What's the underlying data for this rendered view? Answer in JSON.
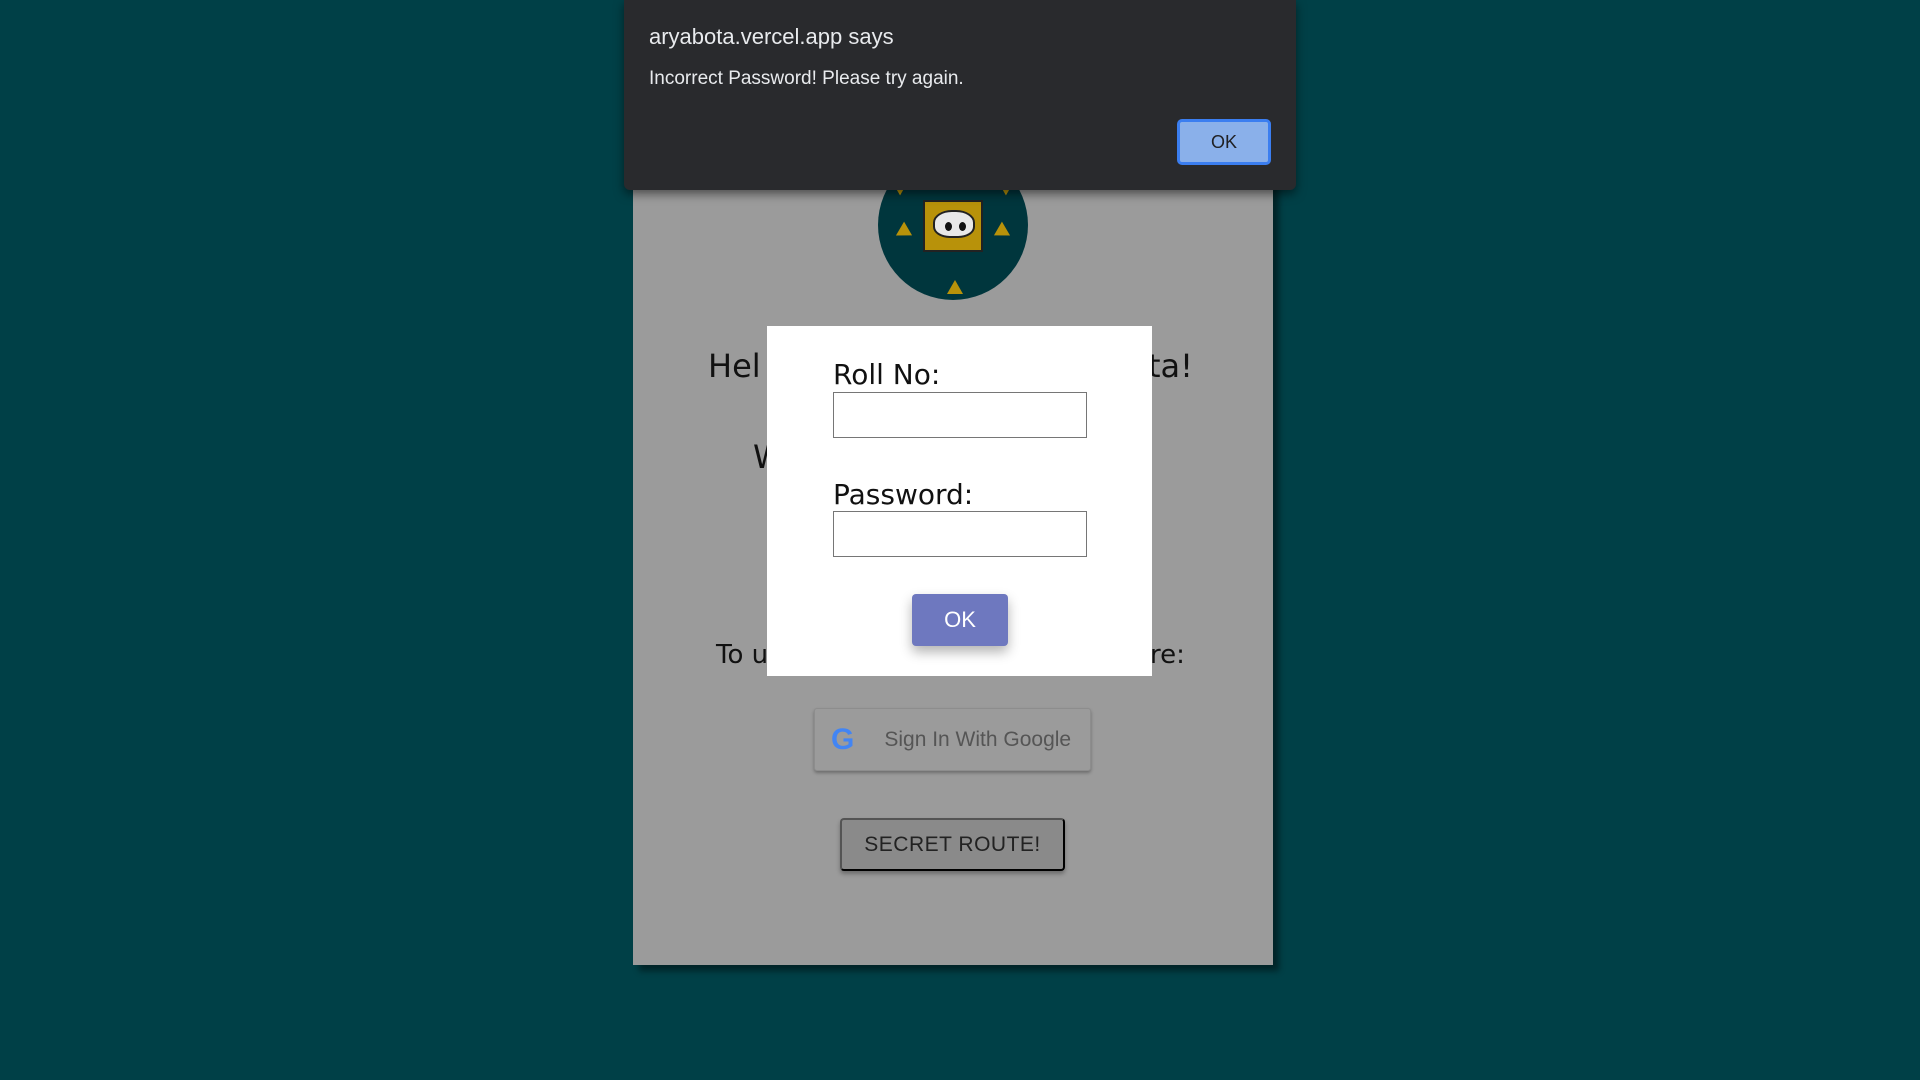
{
  "page": {
    "heading_visible_start": "Hel",
    "heading_visible_end": "ta!",
    "line2_visible_start": "W",
    "line3_visible_start": "To u",
    "line3_visible_end": "re:",
    "google_button_label": "Sign In With Google",
    "google_icon": "G",
    "secret_button_label": "SECRET ROUTE!"
  },
  "modal": {
    "roll_label": "Roll No:",
    "roll_value": "",
    "password_label": "Password:",
    "password_value": "",
    "ok_label": "OK",
    "ok_color": "#6e78bf"
  },
  "alert": {
    "title": "aryabota.vercel.app says",
    "message": "Incorrect Password! Please try again.",
    "ok_label": "OK"
  }
}
